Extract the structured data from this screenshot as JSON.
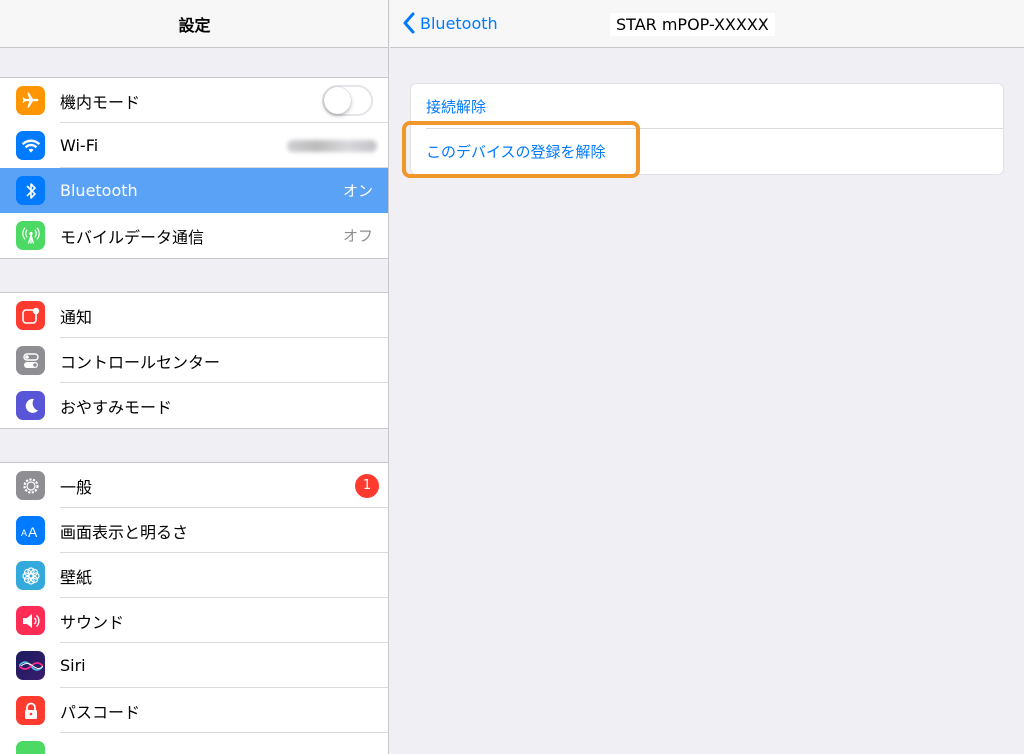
{
  "sidebar": {
    "title": "設定",
    "groups": [
      {
        "items": [
          {
            "label": "機内モード",
            "icon": "airplane-icon",
            "color": "#ff9500",
            "toggle": false
          },
          {
            "label": "Wi-Fi",
            "icon": "wifi-icon",
            "color": "#007aff"
          },
          {
            "label": "Bluetooth",
            "icon": "bluetooth-icon",
            "color": "#007aff",
            "value": "オン",
            "selected": true
          },
          {
            "label": "モバイルデータ通信",
            "icon": "antenna-icon",
            "color": "#4cd964",
            "value": "オフ"
          }
        ]
      },
      {
        "items": [
          {
            "label": "通知",
            "icon": "notifications-icon",
            "color": "#ff3b30"
          },
          {
            "label": "コントロールセンター",
            "icon": "control-center-icon",
            "color": "#8e8e93"
          },
          {
            "label": "おやすみモード",
            "icon": "moon-icon",
            "color": "#5856d6"
          }
        ]
      },
      {
        "items": [
          {
            "label": "一般",
            "icon": "gear-icon",
            "color": "#8e8e93",
            "badge": "1"
          },
          {
            "label": "画面表示と明るさ",
            "icon": "display-brightness-icon",
            "color": "#007aff"
          },
          {
            "label": "壁紙",
            "icon": "wallpaper-icon",
            "color": "#34aadc"
          },
          {
            "label": "サウンド",
            "icon": "speaker-icon",
            "color": "#ff2d55"
          },
          {
            "label": "Siri",
            "icon": "siri-icon",
            "color": "#1c1c5e"
          },
          {
            "label": "パスコード",
            "icon": "lock-icon",
            "color": "#ff3b30"
          }
        ]
      }
    ]
  },
  "detail": {
    "back_label": "Bluetooth",
    "title": "STAR mPOP-XXXXX",
    "actions": [
      {
        "label": "接続解除"
      },
      {
        "label": "このデバイスの登録を解除",
        "highlighted": true
      }
    ],
    "highlight_color": "#f0962b"
  }
}
